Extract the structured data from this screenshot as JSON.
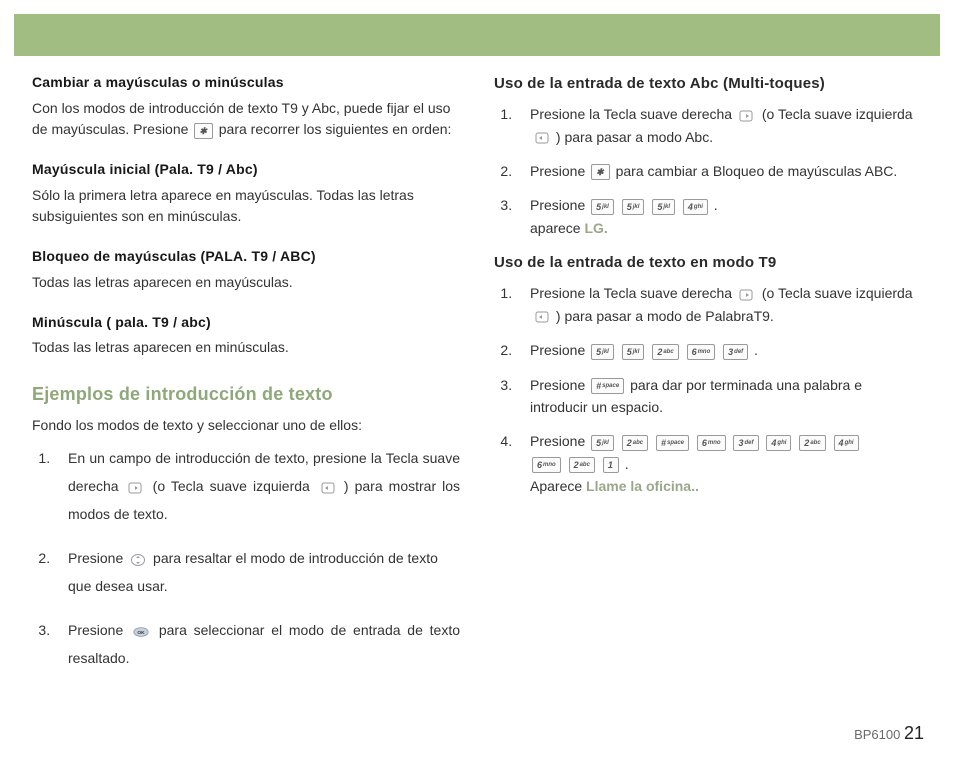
{
  "left": {
    "h1": "Cambiar a mayúsculas o minúsculas",
    "p1a": "Con los modos de introducción de texto T9 y Abc, puede fijar el uso de mayúsculas. Presione ",
    "p1b": " para recorrer los siguientes en orden:",
    "h2": "Mayúscula inicial (Pala. T9 / Abc)",
    "p2": "Sólo la primera letra aparece en mayúsculas. Todas las letras subsiguientes son en minúsculas.",
    "h3": "Bloqueo de mayúsculas (PALA. T9 / ABC)",
    "p3": "Todas las letras aparecen en mayúsculas.",
    "h4": "Minúscula ( pala. T9 / abc)",
    "p4": "Todas las letras aparecen en minúsculas.",
    "sec": "Ejemplos de introducción de texto",
    "secp": "Fondo los modos de texto y seleccionar uno de ellos:",
    "s1a": "En un campo de introducción de texto, presione la Tecla suave derecha ",
    "s1b": " (o Tecla suave izquierda ",
    "s1c": " ) para mostrar los modos de texto.",
    "s2a": "Presione ",
    "s2b": " para resaltar el modo de introducción de texto que desea usar.",
    "s3a": "Presione ",
    "s3b": " para seleccionar el modo de entrada de texto resaltado."
  },
  "right": {
    "h1": "Uso de la entrada de texto Abc (Multi-toques)",
    "a1a": "Presione la Tecla suave derecha ",
    "a1b": " (o Tecla suave izquierda ",
    "a1c": " ) para pasar a modo Abc.",
    "a2a": "Presione ",
    "a2b": " para cambiar a Bloqueo de mayúsculas ABC.",
    "a3a": "Presione ",
    "a3b": ".",
    "a3c": "aparece ",
    "a3r": "LG.",
    "h2": "Uso de la entrada de texto en modo T9",
    "b1a": "Presione la Tecla suave derecha ",
    "b1b": " (o Tecla suave izquierda ",
    "b1c": " ) para pasar a modo de PalabraT9.",
    "b2a": "Presione ",
    "b2b": ".",
    "b3a": "Presione ",
    "b3b": " para dar por terminada una palabra e introducir un espacio.",
    "b4a": "Presione ",
    "b4b": ".",
    "b4c": "Aparece ",
    "b4r": "Llame la oficina.."
  },
  "keys": {
    "star": "✱",
    "hash": "#",
    "k1": "1",
    "k2": "2",
    "k3": "3",
    "k4": "4",
    "k5": "5",
    "k6": "6",
    "abc": "abc",
    "def": "def",
    "ghi": "ghi",
    "jkl": "jkl",
    "mno": "mno",
    "space": "space"
  },
  "footer": {
    "model": "BP6100",
    "page": "21"
  }
}
